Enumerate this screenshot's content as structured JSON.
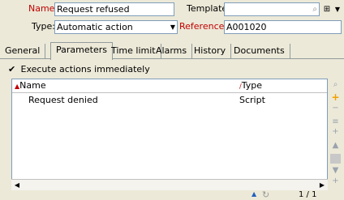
{
  "form": {
    "name_label": "Name:",
    "name_value": "Request refused",
    "template_label": "Template:",
    "template_value": "",
    "type_label": "Type:",
    "type_value": "Automatic action",
    "reference_label": "Reference:",
    "reference_value": "A001020"
  },
  "tabs": [
    {
      "label": "General"
    },
    {
      "label": "Parameters"
    },
    {
      "label": "Time limit"
    },
    {
      "label": "Alarms"
    },
    {
      "label": "History"
    },
    {
      "label": "Documents"
    }
  ],
  "active_tab": "Parameters",
  "execute_checkbox": {
    "label": "Execute actions immediately",
    "checked": true
  },
  "list": {
    "columns": [
      "Name",
      "Type"
    ],
    "rows": [
      {
        "name": "Request denied",
        "type": "Script"
      }
    ]
  },
  "status": {
    "page": "1 / 1"
  },
  "icons": {
    "search": "search-icon",
    "zoom": "zoom-icon",
    "add": "plus-icon",
    "remove": "minus-icon",
    "duplicate": "duplicate-icon",
    "move_up": "move-up-icon",
    "move_down": "move-down-icon",
    "refresh": "refresh-icon"
  },
  "colors": {
    "label_red": "#c00000",
    "add_orange": "#f0a000"
  }
}
